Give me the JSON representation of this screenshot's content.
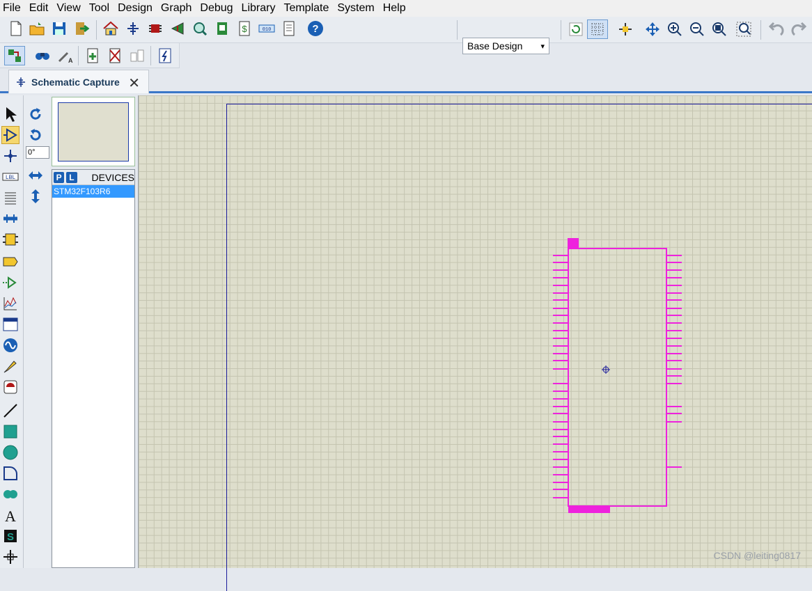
{
  "menu": [
    "File",
    "Edit",
    "View",
    "Tool",
    "Design",
    "Graph",
    "Debug",
    "Library",
    "Template",
    "System",
    "Help"
  ],
  "toolbar": {
    "design_select": "Base Design",
    "icons_row1": [
      "new-file",
      "open-file",
      "save",
      "import",
      "home",
      "schematic",
      "pcb",
      "3d-view",
      "gerber",
      "bom",
      "design-explorer",
      "notes",
      "help",
      "refresh",
      "grid",
      "origin",
      "pan",
      "zoom-in",
      "zoom-out",
      "zoom-all",
      "zoom-area",
      "undo",
      "redo"
    ],
    "icons_row2": [
      "netlist",
      "find",
      "property-assign",
      "new-sheet",
      "delete-sheet",
      "parent-sheet",
      "script"
    ]
  },
  "tab": {
    "label": "Schematic Capture",
    "close": "✕"
  },
  "left_tools": [
    "select",
    "component",
    "junction",
    "wire-label",
    "text-script",
    "bus",
    "subcircuit",
    "terminal",
    "port",
    "generator",
    "graph",
    "recorder",
    "probe-voltage",
    "probe-current",
    "virtual-instrument",
    "line",
    "box",
    "circle",
    "arc",
    "path",
    "text",
    "symbol",
    "marker"
  ],
  "rotation": {
    "angle": "0°"
  },
  "devices": {
    "p_btn": "P",
    "l_btn": "L",
    "title": "DEVICES",
    "items": [
      "STM32F103R6"
    ]
  },
  "chip": {
    "color": "#ee22dd",
    "left_pins": 32,
    "right_pins": 22
  },
  "watermark": "CSDN @leiting0817"
}
